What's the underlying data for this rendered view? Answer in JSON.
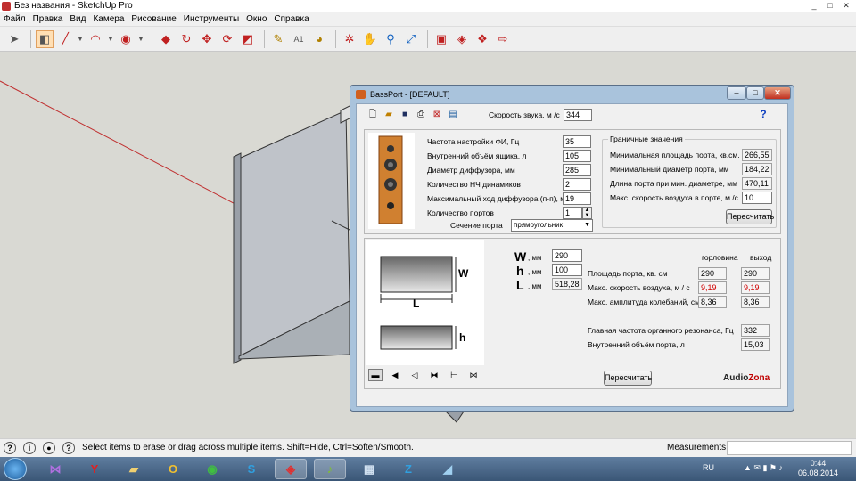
{
  "sketchup": {
    "title": "Без названия - SketchUp Pro",
    "menu": [
      "Файл",
      "Правка",
      "Вид",
      "Камера",
      "Рисование",
      "Инструменты",
      "Окно",
      "Справка"
    ],
    "window_buttons": [
      "_",
      "□",
      "✕"
    ],
    "status_message": "Select items to erase or drag across multiple items. Shift=Hide, Ctrl=Soften/Smooth.",
    "measurements_label": "Measurements",
    "measurements_value": ""
  },
  "bassport": {
    "title": "BassPort - [DEFAULT]",
    "help_label": "?",
    "sound_speed_label": "Скорость звука, м /с",
    "sound_speed_value": "344",
    "params": [
      {
        "label": "Частота настройки ФИ, Гц",
        "value": "35"
      },
      {
        "label": "Внутренний объём ящика, л",
        "value": "105"
      },
      {
        "label": "Диаметр диффузора, мм",
        "value": "285"
      },
      {
        "label": "Количество НЧ динамиков",
        "value": "2"
      },
      {
        "label": "Максимальный ход диффузора (п-п), мм",
        "value": "19"
      },
      {
        "label": "Количество портов",
        "value": "1"
      }
    ],
    "port_section_label": "Сечение порта",
    "port_section_value": "прямоугольник",
    "limits": {
      "title": "Граничные значения",
      "rows": [
        {
          "label": "Минимальная площадь порта, кв.см.",
          "value": "266,55"
        },
        {
          "label": "Минимальный диаметр порта, мм",
          "value": "184,22"
        },
        {
          "label": "Длина порта при мин. диаметре, мм",
          "value": "470,11"
        },
        {
          "label": "Макс. скорость воздуха в порте, м /с",
          "value": "10"
        }
      ],
      "recalc_label": "Пересчитать"
    },
    "dims": [
      {
        "letter": "W",
        "unit": ", мм",
        "value": "290"
      },
      {
        "letter": "h",
        "unit": ", мм",
        "value": "100"
      },
      {
        "letter": "L",
        "unit": ", мм",
        "value": "518,28"
      }
    ],
    "diagram_labels": {
      "W": "W",
      "L": "L",
      "h": "h"
    },
    "results": {
      "col_throat": "горловина",
      "col_exit": "выход",
      "rows": [
        {
          "label": "Площадь порта, кв. см",
          "throat": "290",
          "exit": "290"
        },
        {
          "label": "Макс. скорость воздуха, м / с",
          "throat": "9,19",
          "exit": "9,19"
        },
        {
          "label": "Макс. амплитуда колебаний, см",
          "throat": "8,36",
          "exit": "8,36"
        }
      ],
      "organ_label": "Главная частота органного резонанса, Гц",
      "organ_value": "332",
      "volume_label": "Внутренний объём порта, л",
      "volume_value": "15,03"
    },
    "recalc_bottom_label": "Пересчитать",
    "brand_a": "Audio",
    "brand_b": "Zona",
    "colors": {
      "red_value": "#d00000",
      "brand_red": "#c00000"
    }
  },
  "taskbar": {
    "lang": "RU",
    "time": "0:44",
    "date": "06.08.2014"
  }
}
